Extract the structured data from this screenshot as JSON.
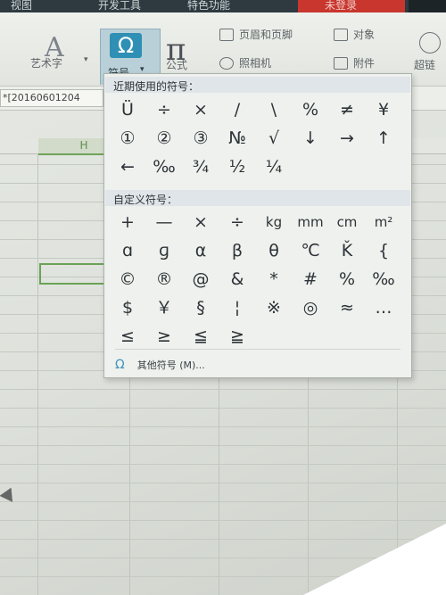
{
  "menubar": {
    "tabs": [
      "视图",
      "开发工具",
      "特色功能"
    ],
    "member_label": "未登录"
  },
  "ribbon": {
    "wordart_label": "艺术字",
    "symbol_label": "符号",
    "formula_label": "公式",
    "header_footer_label": "页眉和页脚",
    "object_label": "对象",
    "camera_label": "照相机",
    "attachment_label": "附件",
    "hyperlink_label": "超链"
  },
  "formula_bar": {
    "cell_value": "*[20160601204"
  },
  "sheet": {
    "column_header": "H"
  },
  "symbol_panel": {
    "recent_title": "近期使用的符号：",
    "recent_symbols": [
      "Ü",
      "÷",
      "×",
      "/",
      "\\",
      "%",
      "≠",
      "¥",
      "①",
      "②",
      "③",
      "№",
      "√",
      "↓",
      "→",
      "↑",
      "←",
      "‰",
      "¾",
      "½",
      "¼"
    ],
    "custom_title": "自定义符号：",
    "custom_symbols": [
      "+",
      "—",
      "×",
      "÷",
      "kg",
      "mm",
      "cm",
      "m²",
      "ɑ",
      "ɡ",
      "α",
      "β",
      "θ",
      "℃",
      "Ǩ",
      "{",
      "©",
      "®",
      "@",
      "&",
      "*",
      "#",
      "%",
      "‰",
      "$",
      "￥",
      "§",
      "¦",
      "※",
      "◎",
      "≈",
      "…",
      "≤",
      "≥",
      "≦",
      "≧"
    ],
    "more_label": "其他符号 (M)..."
  }
}
